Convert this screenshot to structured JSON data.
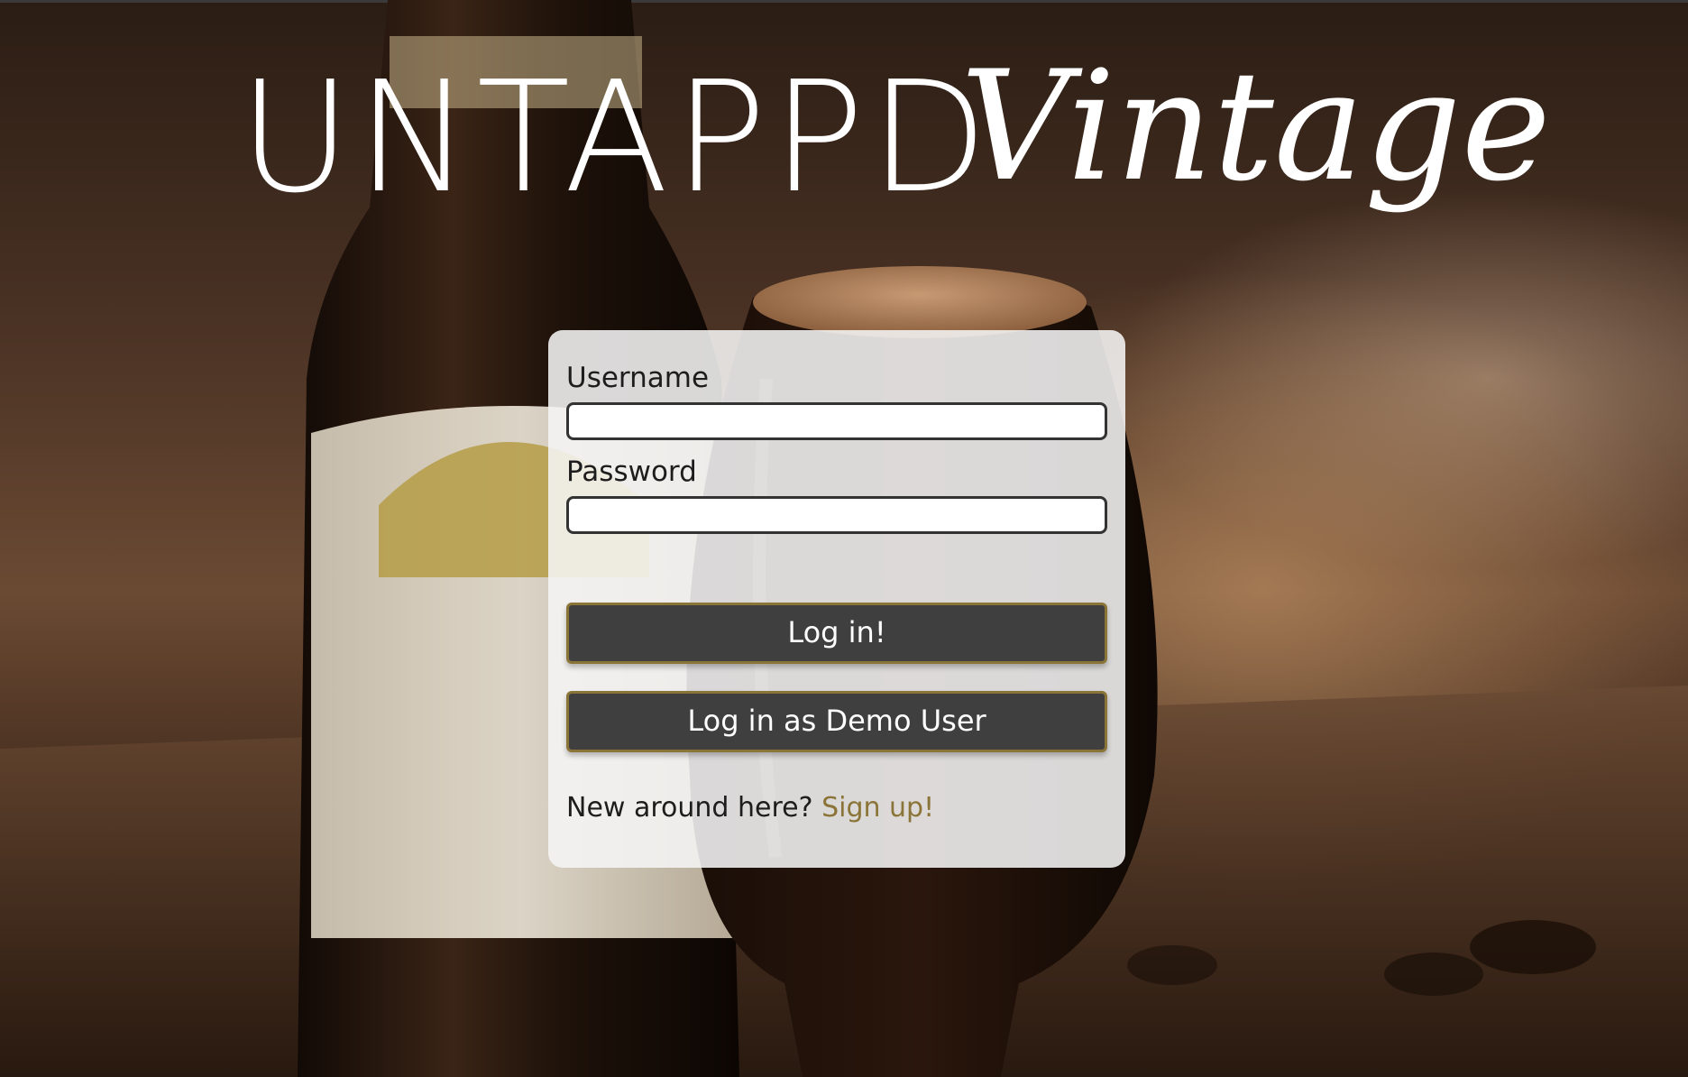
{
  "logo": {
    "main_text": "UNTAPPD",
    "script_text": "Vintage"
  },
  "form": {
    "username_label": "Username",
    "username_value": "",
    "password_label": "Password",
    "password_value": "",
    "login_button": "Log in!",
    "demo_button": "Log in as Demo User",
    "signup_prompt": "New around here?",
    "signup_link": "Sign up!"
  },
  "colors": {
    "accent": "#8a7437",
    "button_bg": "#3f3f3f",
    "card_bg": "#f5f5f5"
  }
}
